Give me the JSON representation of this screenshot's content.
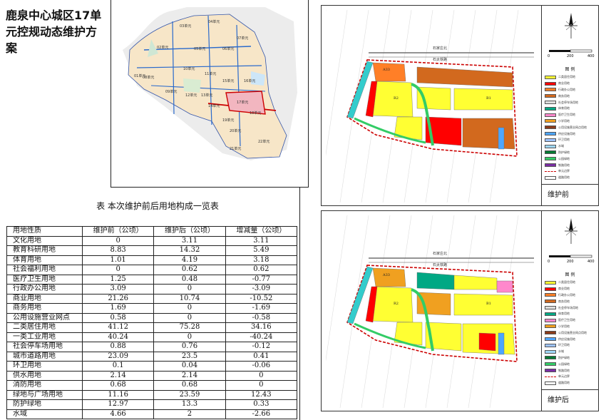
{
  "doc": {
    "title": "鹿泉中心城区17单元控规动态维护方案",
    "table_caption": "表    本次维护前后用地构成一览表"
  },
  "table": {
    "headers": [
      "用地性质",
      "维护前（公顷）",
      "维护后（公顷）",
      "增减量（公顷）"
    ],
    "rows": [
      [
        "文化用地",
        "0",
        "3.11",
        "3.11"
      ],
      [
        "教育科研用地",
        "8.83",
        "14.32",
        "5.49"
      ],
      [
        "体育用地",
        "1.01",
        "4.19",
        "3.18"
      ],
      [
        "社会福利用地",
        "0",
        "0.62",
        "0.62"
      ],
      [
        "医疗卫生用地",
        "1.25",
        "0.48",
        "-0.77"
      ],
      [
        "行政办公用地",
        "3.09",
        "0",
        "-3.09"
      ],
      [
        "商业用地",
        "21.26",
        "10.74",
        "-10.52"
      ],
      [
        "商务用地",
        "1.69",
        "0",
        "-1.69"
      ],
      [
        "公用设施营业网点",
        "0.58",
        "0",
        "-0.58"
      ],
      [
        "二类居住用地",
        "41.12",
        "75.28",
        "34.16"
      ],
      [
        "一类工业用地",
        "40.24",
        "0",
        "-40.24"
      ],
      [
        "社会停车场用地",
        "0.88",
        "0.76",
        "-0.12"
      ],
      [
        "城市道路用地",
        "23.09",
        "23.5",
        "0.41"
      ],
      [
        "环卫用地",
        "0.1",
        "0.04",
        "-0.06"
      ],
      [
        "供水用地",
        "2.14",
        "2.14",
        "0"
      ],
      [
        "消防用地",
        "0.68",
        "0.68",
        "0"
      ],
      [
        "绿地与广场用地",
        "11.16",
        "23.59",
        "12.43"
      ],
      [
        "防护绿地",
        "12.97",
        "13.3",
        "0.33"
      ],
      [
        "水域",
        "4.66",
        "2",
        "-2.66"
      ]
    ]
  },
  "key_map": {
    "units": [
      "01单元",
      "02单元",
      "03单元",
      "04单元",
      "05单元",
      "06单元",
      "07单元",
      "08单元",
      "09单元",
      "10单元",
      "11单元",
      "12单元",
      "13单元",
      "14单元",
      "15单元",
      "16单元",
      "17单元",
      "18单元",
      "19单元",
      "20单元",
      "21单元",
      "22单元"
    ]
  },
  "plans": {
    "before_caption": "维护前",
    "after_caption": "维护后",
    "legend_title": "图  例",
    "scale_labels": [
      "0",
      "200",
      "400"
    ],
    "road_labels": [
      "石家庄北",
      "石太铁路",
      "文兴路",
      "文化路"
    ],
    "parcel_labels": [
      "A33",
      "R2",
      "B1"
    ],
    "legend_items": [
      {
        "label": "二类居住用地",
        "color": "#ffff33"
      },
      {
        "label": "商业用地",
        "color": "#ff0000"
      },
      {
        "label": "行政办公用地",
        "color": "#ff7f27"
      },
      {
        "label": "商务用地",
        "color": "#d2691e"
      },
      {
        "label": "社会停车场用地",
        "color": "#dddddd"
      },
      {
        "label": "体育用地",
        "color": "#00a884"
      },
      {
        "label": "医疗卫生用地",
        "color": "#ff88cc"
      },
      {
        "label": "小学用地",
        "color": "#f0a020"
      },
      {
        "label": "公用设施营业网点用地",
        "color": "#8b3a1a"
      },
      {
        "label": "供应设施用地",
        "color": "#4da6ff"
      },
      {
        "label": "环卫用地",
        "color": "#9ec3ff"
      },
      {
        "label": "水域",
        "color": "#9fd7f7"
      },
      {
        "label": "防护绿地",
        "color": "#007a33"
      },
      {
        "label": "公园绿地",
        "color": "#33cc66"
      },
      {
        "label": "铁路用地",
        "color": "#7a2ea3"
      },
      {
        "label": "单元边界",
        "color": "#cc0000"
      },
      {
        "label": "道路用地",
        "color": "#ffffff"
      }
    ]
  }
}
